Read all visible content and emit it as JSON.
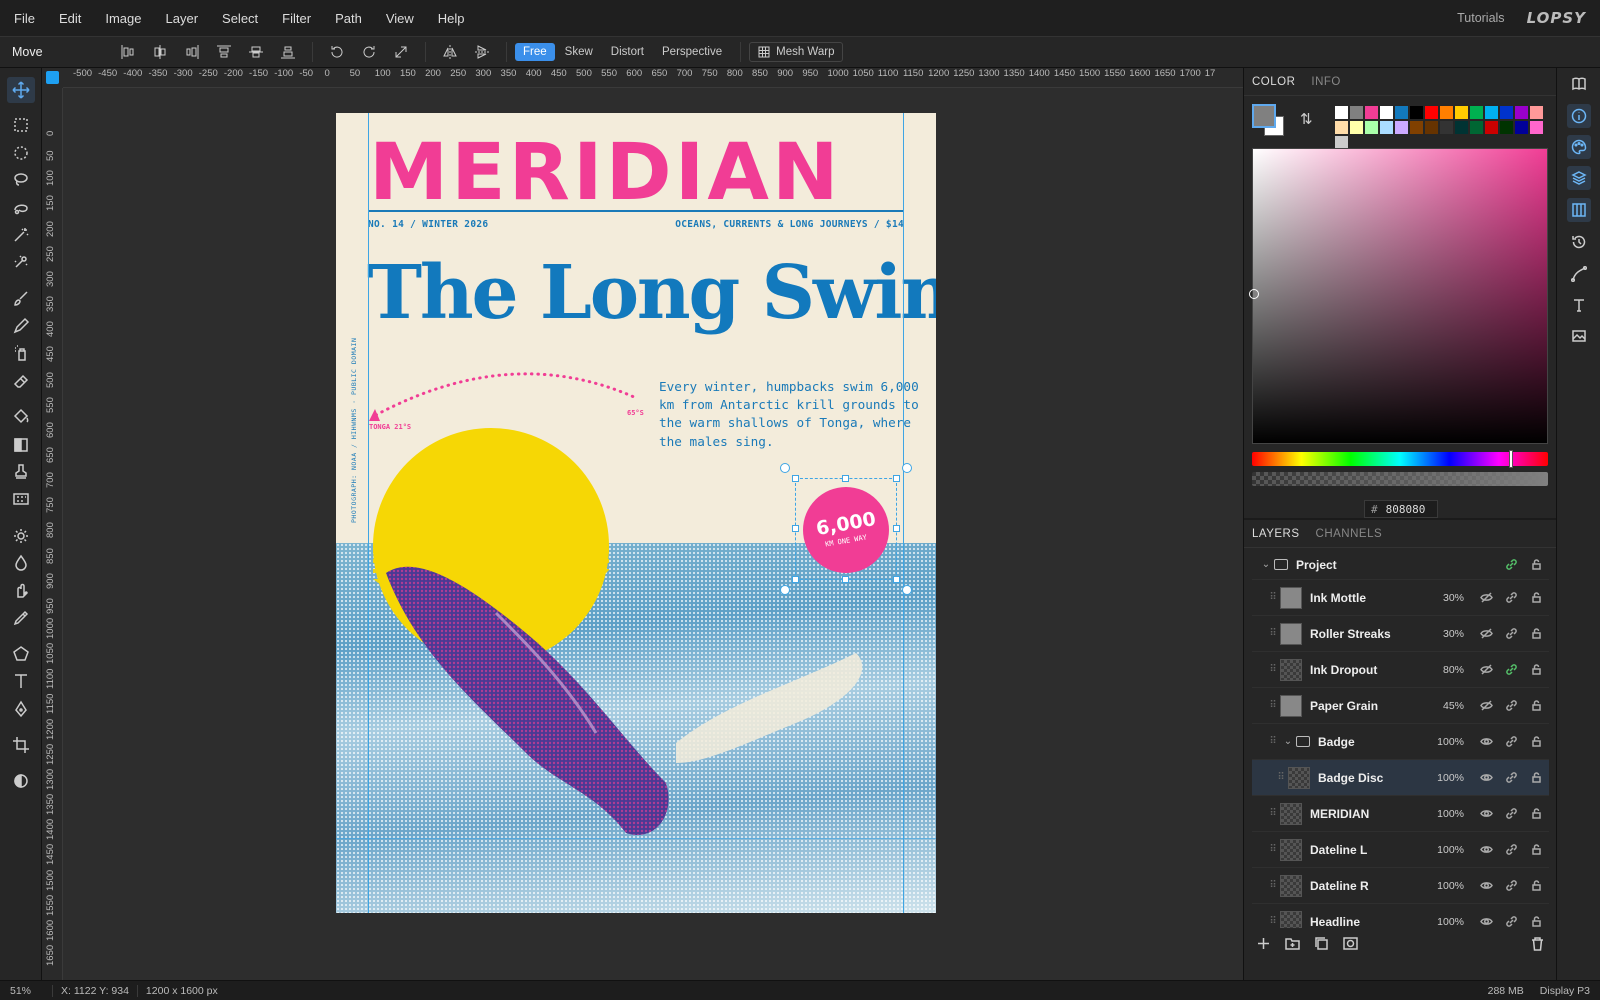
{
  "menubar": {
    "items": [
      "File",
      "Edit",
      "Image",
      "Layer",
      "Select",
      "Filter",
      "Path",
      "View",
      "Help"
    ],
    "tutorials": "Tutorials",
    "logo": "LOPSY"
  },
  "toolbar": {
    "tool_name": "Move",
    "modes": [
      "Free",
      "Skew",
      "Distort",
      "Perspective"
    ],
    "active_mode": "Free",
    "mesh_warp": "Mesh Warp"
  },
  "rulers": {
    "h": [
      "-500",
      "-450",
      "-400",
      "-350",
      "-300",
      "-250",
      "-200",
      "-150",
      "-100",
      "-50",
      "0",
      "50",
      "100",
      "150",
      "200",
      "250",
      "300",
      "350",
      "400",
      "450",
      "500",
      "550",
      "600",
      "650",
      "700",
      "750",
      "800",
      "850",
      "900",
      "950",
      "1000",
      "1050",
      "1100",
      "1150",
      "1200",
      "1250",
      "1300",
      "1350",
      "1400",
      "1450",
      "1500",
      "1550",
      "1600",
      "1650",
      "1700",
      "17"
    ],
    "v": [
      "0",
      "50",
      "100",
      "150",
      "200",
      "250",
      "300",
      "350",
      "400",
      "450",
      "500",
      "550",
      "600",
      "650",
      "700",
      "750",
      "800",
      "850",
      "900",
      "950",
      "1000",
      "1050",
      "1100",
      "1150",
      "1200",
      "1250",
      "1300",
      "1350",
      "1400",
      "1450",
      "1500",
      "1550",
      "1600",
      "1650"
    ]
  },
  "doc": {
    "masthead": "MERIDIAN",
    "dateline_left": "NO. 14  /  WINTER 2026",
    "dateline_right": "OCEANS, CURRENTS & LONG JOURNEYS  /  $14",
    "headline": "The Long Swim",
    "deck": "Every winter, humpbacks swim 6,000 km from Antarctic krill grounds to the warm shallows of Tonga, where the males sing.",
    "arc_left": "TONGA 21°S",
    "arc_right": "65°S",
    "credit": "PHOTOGRAPH: NOAA / HIHWNMS  ·  PUBLIC DOMAIN",
    "badge_number": "6,000",
    "badge_sub": "KM ONE WAY"
  },
  "color_panel": {
    "tabs": [
      "COLOR",
      "INFO"
    ],
    "active": "COLOR",
    "fg": "#808080",
    "bg": "#ffffff",
    "hex_label": "#",
    "hex": "808080",
    "swatches": [
      "#ffffff",
      "#808080",
      "#f13d95",
      "#ffffff",
      "#1279bd",
      "#000000",
      "#ff0000",
      "#ff7f00",
      "#ffcc00",
      "#00b050",
      "#00b0f0",
      "#0033cc",
      "#9900cc",
      "#ff9999",
      "#ffddaa",
      "#ffffaa",
      "#aaffaa",
      "#aaddff",
      "#ccaaff",
      "#804000",
      "#663300",
      "#333333",
      "#003333",
      "#006633",
      "#cc0000",
      "#003300",
      "#000099",
      "#ff66cc",
      "#cccccc"
    ]
  },
  "layers_panel": {
    "tabs": [
      "LAYERS",
      "CHANNELS"
    ],
    "active": "LAYERS",
    "rows": [
      {
        "name": "Project",
        "opacity": "",
        "visible": true,
        "group": true,
        "indent": 0,
        "selected": false,
        "link_green": true
      },
      {
        "name": "Ink Mottle",
        "opacity": "30%",
        "visible": false,
        "group": false,
        "indent": 1,
        "selected": false,
        "link_green": false
      },
      {
        "name": "Roller Streaks",
        "opacity": "30%",
        "visible": false,
        "group": false,
        "indent": 1,
        "selected": false,
        "link_green": false
      },
      {
        "name": "Ink Dropout",
        "opacity": "80%",
        "visible": false,
        "group": false,
        "indent": 1,
        "selected": false,
        "link_green": true
      },
      {
        "name": "Paper Grain",
        "opacity": "45%",
        "visible": false,
        "group": false,
        "indent": 1,
        "selected": false,
        "link_green": false
      },
      {
        "name": "Badge",
        "opacity": "100%",
        "visible": true,
        "group": true,
        "indent": 1,
        "selected": false,
        "link_green": false
      },
      {
        "name": "Badge Disc",
        "opacity": "100%",
        "visible": true,
        "group": false,
        "indent": 2,
        "selected": true,
        "link_green": false
      },
      {
        "name": "MERIDIAN",
        "opacity": "100%",
        "visible": true,
        "group": false,
        "indent": 1,
        "selected": false,
        "link_green": false
      },
      {
        "name": "Dateline L",
        "opacity": "100%",
        "visible": true,
        "group": false,
        "indent": 1,
        "selected": false,
        "link_green": false
      },
      {
        "name": "Dateline R",
        "opacity": "100%",
        "visible": true,
        "group": false,
        "indent": 1,
        "selected": false,
        "link_green": false
      },
      {
        "name": "Headline",
        "opacity": "100%",
        "visible": true,
        "group": false,
        "indent": 1,
        "selected": false,
        "link_green": false
      }
    ]
  },
  "status": {
    "zoom": "51%",
    "coords": "X: 1122  Y: 934",
    "size": "1200 x 1600 px",
    "memory": "288 MB",
    "profile": "Display P3"
  }
}
